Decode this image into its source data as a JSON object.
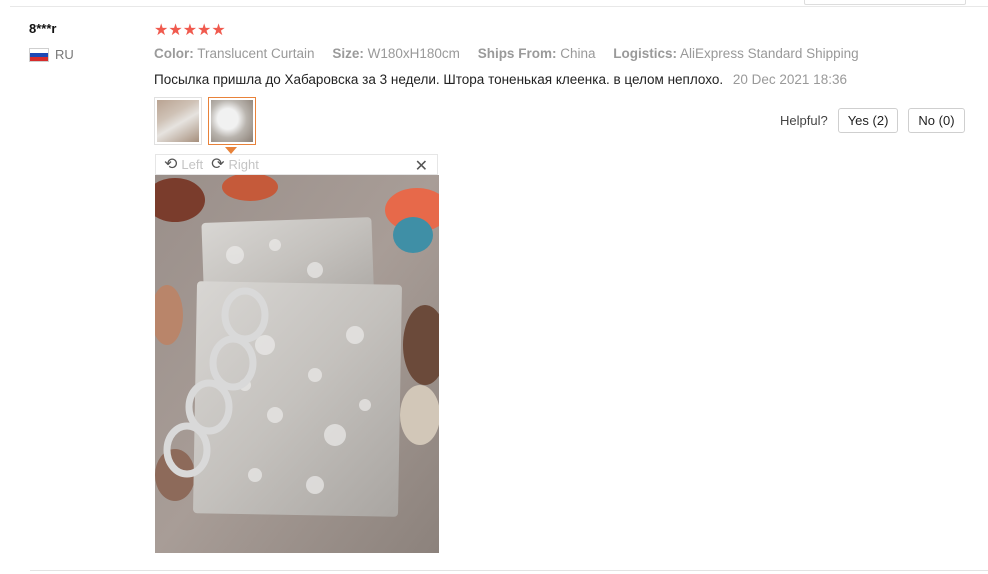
{
  "review": {
    "username": "8***r",
    "country_code": "RU",
    "rating": 5,
    "stars": "★★★★★",
    "attributes": [
      {
        "key": "Color:",
        "value": "Translucent Curtain"
      },
      {
        "key": "Size:",
        "value": "W180xH180cm"
      },
      {
        "key": "Ships From:",
        "value": "China"
      },
      {
        "key": "Logistics:",
        "value": "AliExpress Standard Shipping"
      }
    ],
    "text": "Посылка пришла до Хабаровска за 3 недели. Штора тоненькая клеенка. в целом неплохо.",
    "date": "20 Dec 2021 18:36"
  },
  "viewer": {
    "rotate_left_label": "Left",
    "rotate_right_label": "Right",
    "close_symbol": "✕"
  },
  "helpful": {
    "label": "Helpful?",
    "yes_label": "Yes (2)",
    "no_label": "No (0)"
  },
  "colors": {
    "star": "#f05a4e",
    "active_thumb": "#e8823a"
  },
  "icons": {
    "rotate_left": "rotate-left-icon",
    "rotate_right": "rotate-right-icon",
    "close": "close-icon",
    "flag": "russia-flag-icon"
  }
}
